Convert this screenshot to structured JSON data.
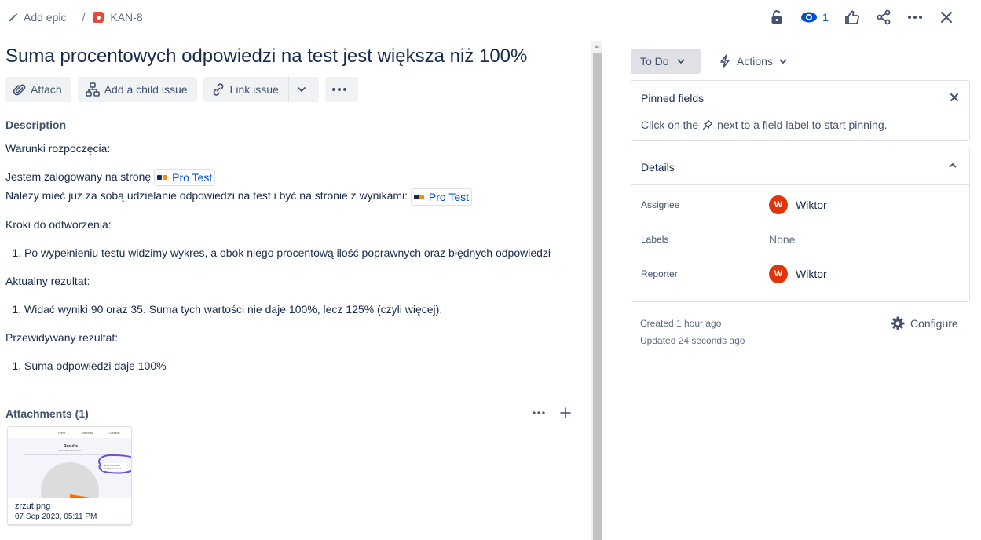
{
  "breadcrumb": {
    "add_epic": "Add epic",
    "separator": "/",
    "issue_key": "KAN-8"
  },
  "top_actions": {
    "watch_count": "1"
  },
  "issue": {
    "title": "Suma procentowych odpowiedzi na test jest większa niż 100%"
  },
  "toolbar": {
    "attach": "Attach",
    "add_child": "Add a child issue",
    "link_issue": "Link issue"
  },
  "description": {
    "heading": "Description",
    "line1": "Warunki rozpoczęcia:",
    "line2_text": "Jestem zalogowany na stronę",
    "line2_link": "Pro Test",
    "line3_text": "Należy mieć już za sobą udzielanie odpowiedzi na test i być na stronie z wynikami:",
    "line3_link": "Pro Test",
    "steps_heading": "Kroki do odtworzenia:",
    "step1": "Po wypełnieniu testu widzimy wykres, a obok niego procentową ilość poprawnych oraz błędnych odpowiedzi",
    "actual_heading": "Aktualny rezultat:",
    "actual1": "Widać wyniki 90 oraz 35. Suma tych wartości nie daje 100%, lecz 125% (czyli więcej).",
    "expected_heading": "Przewidywany rezultat:",
    "expected1": "Suma odpowiedzi daje 100%"
  },
  "attachments": {
    "heading": "Attachments (1)",
    "items": [
      {
        "filename": "zrzut.png",
        "date": "07 Sep 2023, 05:11 PM",
        "preview": {
          "nav": [
            "Home",
            "Materials",
            "Contacts"
          ],
          "title": "Results",
          "subtitle": "( TESTING THEORY )",
          "legend": [
            "90% Correct",
            "35% Incorrect"
          ]
        }
      }
    ]
  },
  "sidebar": {
    "status": "To Do",
    "actions": "Actions",
    "pinned": {
      "heading": "Pinned fields",
      "hint_before": "Click on the",
      "hint_after": "next to a field label to start pinning."
    },
    "details": {
      "heading": "Details",
      "assignee_label": "Assignee",
      "assignee_initial": "W",
      "assignee_name": "Wiktor",
      "labels_label": "Labels",
      "labels_value": "None",
      "reporter_label": "Reporter",
      "reporter_initial": "W",
      "reporter_name": "Wiktor"
    },
    "created": "Created 1 hour ago",
    "updated": "Updated 24 seconds ago",
    "configure": "Configure"
  },
  "colors": {
    "accent": "#0052cc",
    "bug": "#e5493a",
    "avatar": "#de350b"
  }
}
